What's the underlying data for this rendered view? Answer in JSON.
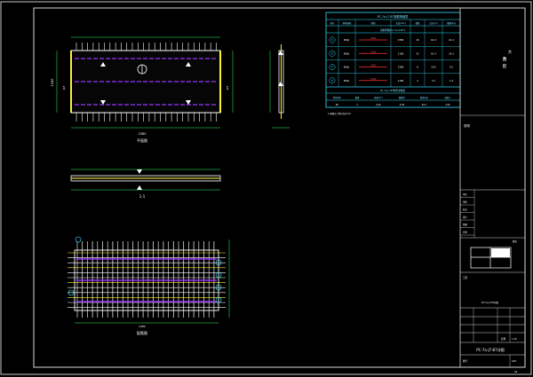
{
  "colors": {
    "background": "#000000",
    "frame": "#d9d9d9",
    "rebar_main": "#ffffff",
    "rebar_secondary": "#ffee33",
    "dim_line": "#33ff66",
    "table_cyan": "#33e0ff",
    "hidden_line": "#9933ff",
    "red_mark": "#ff3333",
    "yellow_edge": "#ffee33"
  },
  "schedule_table": {
    "title": "PC-7a-J7-B7钢筋明细表",
    "headers": [
      "编号",
      "钢筋规格",
      "简图",
      "长度(mm)",
      "根数",
      "总长(m)",
      "重量(kg)"
    ],
    "sub_header": "钢筋明细(PC-7a-J7-B7)",
    "rows": [
      {
        "id": "①",
        "spec": "Φ8@",
        "len": "2380",
        "num": "26",
        "total": "61.9",
        "weight": "24.4"
      },
      {
        "id": "②",
        "spec": "Φ8@",
        "len": "1180",
        "num": "52",
        "total": "61.4",
        "weight": "24.2"
      },
      {
        "id": "③",
        "spec": "Φ6@",
        "len": "2380",
        "num": "8",
        "total": "19.0",
        "weight": "4.2"
      },
      {
        "id": "④",
        "spec": "Φ8@",
        "len": "1180",
        "num": "4",
        "total": "4.7",
        "weight": "1.9"
      }
    ],
    "summary_title": "PC-7a-J7-B7构件参数表",
    "summary_headers": [
      "构件编号",
      "数量",
      "体积(m³)",
      "重量(t)",
      "钢筋(kg)",
      "混凝土"
    ],
    "summary_row": [
      "B7",
      "1",
      "0.22",
      "0.55",
      "54.7",
      "C30"
    ]
  },
  "notes_label": "说明",
  "notes_small": "1.本图尺寸单位均为mm",
  "title_block": {
    "company_lines": [
      "大",
      "力",
      "装",
      "配"
    ],
    "rows": [
      "审定",
      "审核",
      "校对",
      "设计",
      "制图",
      "日期"
    ],
    "project_label": "工程",
    "stage_label": "阶段",
    "scale_label": "比例",
    "scale_value": "1:25",
    "drawing_title": "PC-7a-J7-B7详图",
    "sheet_label": "图号",
    "sheet_value": "A03",
    "page_number": "42"
  },
  "views": {
    "plan_label": "平面图",
    "section_label": "1-1",
    "rebar_label": "配筋图",
    "dim_total": "2380",
    "dim_width": "1180",
    "section_mark": "1",
    "rebar_dim": "2380"
  }
}
